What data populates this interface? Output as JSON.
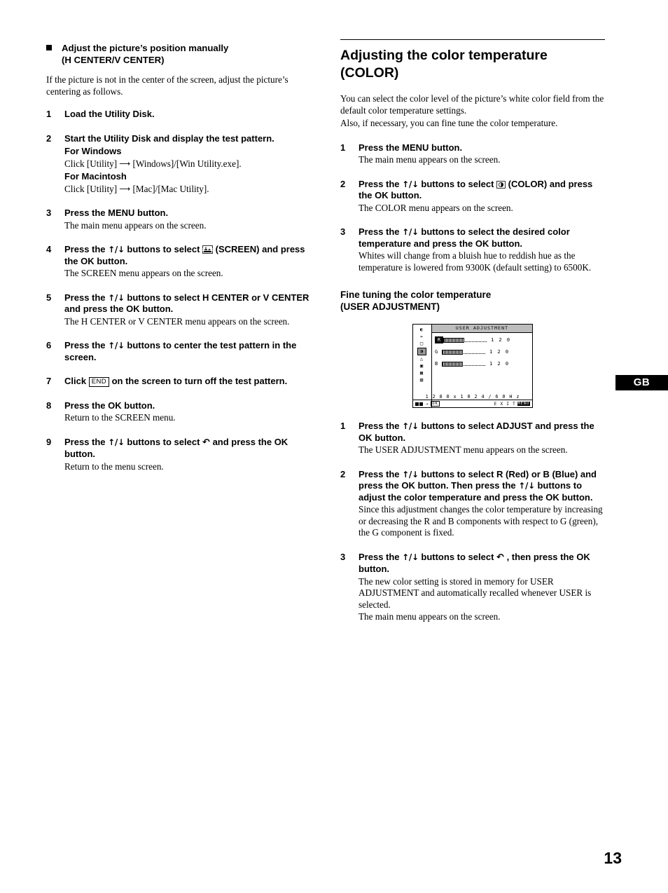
{
  "page_number": "13",
  "lang_tab": "GB",
  "left": {
    "heading_line1": "Adjust the picture’s position manually",
    "heading_line2": "(H CENTER/V CENTER)",
    "intro": "If the picture is not in the center of the screen, adjust the picture’s centering as follows.",
    "steps": [
      {
        "num": "1",
        "lead": "Load the Utility Disk.",
        "desc": ""
      },
      {
        "num": "2",
        "lead": "Start the Utility Disk and display the test pattern.",
        "sub1": "For Windows",
        "desc1_pre": "Click [Utility]",
        "desc1_post": "[Windows]/[Win Utility.exe].",
        "sub2": "For Macintosh",
        "desc2_pre": "Click [Utility]",
        "desc2_post": "[Mac]/[Mac Utility]."
      },
      {
        "num": "3",
        "lead": "Press the MENU button.",
        "desc": "The main menu appears on the screen."
      },
      {
        "num": "4",
        "lead_pre": "Press the",
        "lead_arrows": "↑/↓",
        "lead_mid": "buttons to select",
        "lead_post": "(SCREEN) and press the OK button.",
        "desc": "The SCREEN menu appears on the screen."
      },
      {
        "num": "5",
        "lead_pre": "Press the",
        "lead_arrows": "↑/↓",
        "lead_post": "buttons to select H CENTER or V CENTER and press the OK button.",
        "desc": "The H CENTER or V CENTER menu appears on the screen."
      },
      {
        "num": "6",
        "lead_pre": "Press the",
        "lead_arrows": "↑/↓",
        "lead_post": "buttons to center the test pattern in the screen.",
        "desc": ""
      },
      {
        "num": "7",
        "lead_pre": "Click",
        "key": "END",
        "lead_post": "on the screen to turn off the test pattern.",
        "desc": ""
      },
      {
        "num": "8",
        "lead": "Press the OK button.",
        "desc": "Return to the SCREEN menu."
      },
      {
        "num": "9",
        "lead_pre": "Press the",
        "lead_arrows": "↑/↓",
        "lead_mid": "buttons to select",
        "lead_post": "and press the OK button.",
        "desc": "Return to the menu screen."
      }
    ]
  },
  "right": {
    "heading_line1": "Adjusting the color temperature",
    "heading_line2": "(COLOR)",
    "intro_line1": "You can select the color level of the picture’s white color field from the default color temperature settings.",
    "intro_line2": "Also, if necessary, you can fine tune the color temperature.",
    "steps": [
      {
        "num": "1",
        "lead": "Press the MENU button.",
        "desc": "The main menu appears on the screen."
      },
      {
        "num": "2",
        "lead_pre": "Press the",
        "lead_arrows": "↑/↓",
        "lead_mid": "buttons to select",
        "lead_post": "(COLOR) and press the OK button.",
        "desc": "The COLOR menu appears on the screen."
      },
      {
        "num": "3",
        "lead_pre": "Press the",
        "lead_arrows": "↑/↓",
        "lead_post": "buttons to select the desired color temperature and press the OK button.",
        "desc": "Whites will change from a bluish hue to reddish hue as the temperature is lowered from 9300K (default setting) to 6500K."
      }
    ],
    "subsection_line1": "Fine tuning the color temperature",
    "subsection_line2": "(USER ADJUSTMENT)",
    "osd": {
      "title": "USER ADJUSTMENT",
      "rows": [
        {
          "label": "R",
          "value": "1 2 0",
          "selected": true
        },
        {
          "label": "G",
          "value": "1 2 0",
          "selected": false
        },
        {
          "label": "B",
          "value": "1 2 0",
          "selected": false
        }
      ],
      "resolution": "1 2 8 0 x 1 0 2 4 / 6 0 H z",
      "footer_exit": "E X I T",
      "footer_ok": "OK",
      "footer_key": "MENU"
    },
    "steps2": [
      {
        "num": "1",
        "lead_pre": "Press the",
        "lead_arrows": "↑/↓",
        "lead_post": "buttons to select ADJUST and press the OK button.",
        "desc": "The USER ADJUSTMENT menu appears on the screen."
      },
      {
        "num": "2",
        "lead_pre": "Press the",
        "lead_arrows": "↑/↓",
        "lead_mid": "buttons to select R (Red) or B (Blue) and press the OK button. Then press the",
        "lead_arrows2": "↑/↓",
        "lead_post": "buttons to adjust the color temperature and press the OK button.",
        "desc": "Since this adjustment changes the color temperature by increasing or decreasing the R and B components with respect to G (green), the G component is fixed."
      },
      {
        "num": "3",
        "lead_pre": "Press the",
        "lead_arrows": "↑/↓",
        "lead_mid": "buttons to select",
        "lead_post": ", then press the OK button.",
        "desc1": "The new color setting is stored in memory for USER ADJUSTMENT and automatically recalled whenever USER is selected.",
        "desc2": "The main menu appears on the screen."
      }
    ]
  }
}
